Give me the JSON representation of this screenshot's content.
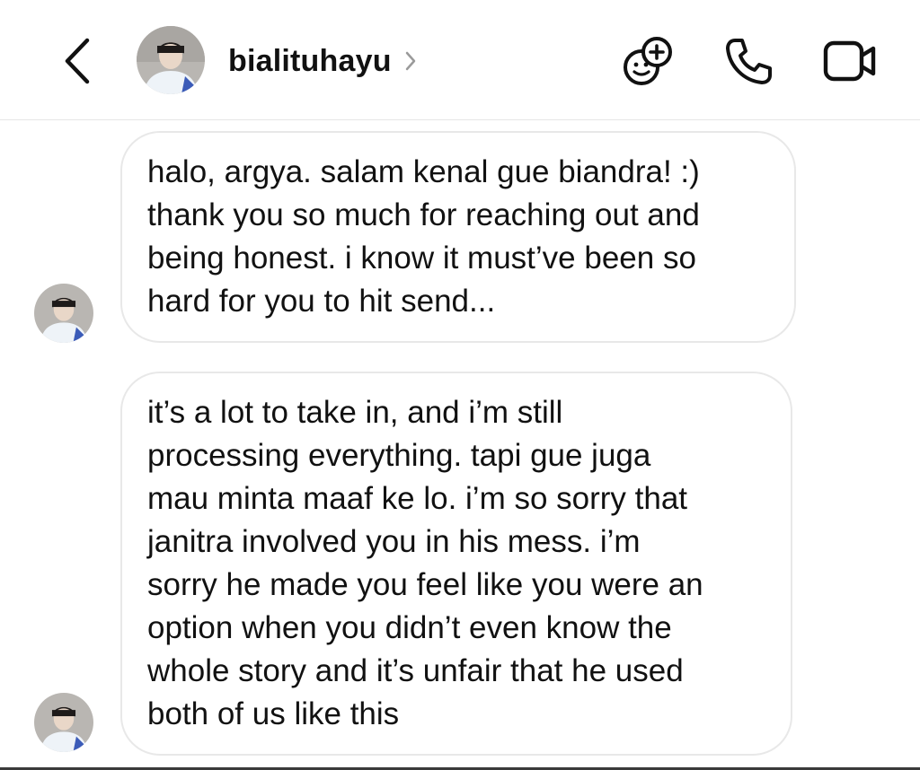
{
  "header": {
    "username": "bialituhayu",
    "icons": {
      "back": "chevron-left-icon",
      "profile_chevron": "chevron-right-icon",
      "effects": "sticker-add-icon",
      "call": "phone-icon",
      "video": "video-camera-icon"
    }
  },
  "messages": [
    {
      "sender": "bialituhayu",
      "text": "halo, argya. salam kenal gue biandra! :)\nthank you so much for reaching out and\nbeing honest. i know it must’ve been so\nhard for you to hit send..."
    },
    {
      "sender": "bialituhayu",
      "text": "it’s a lot to take in, and i’m still\nprocessing everything. tapi gue juga\nmau minta maaf ke lo. i’m so sorry that\njanitra involved you in his mess. i’m\nsorry he made you feel like you were an\noption when you didn’t even know the\nwhole story and it’s unfair that he used\nboth of us like this"
    }
  ],
  "colors": {
    "text": "#111111",
    "bubble_border": "#e8e8e8",
    "divider": "#e6e6e6",
    "chevron_gray": "#9a9a9a"
  }
}
